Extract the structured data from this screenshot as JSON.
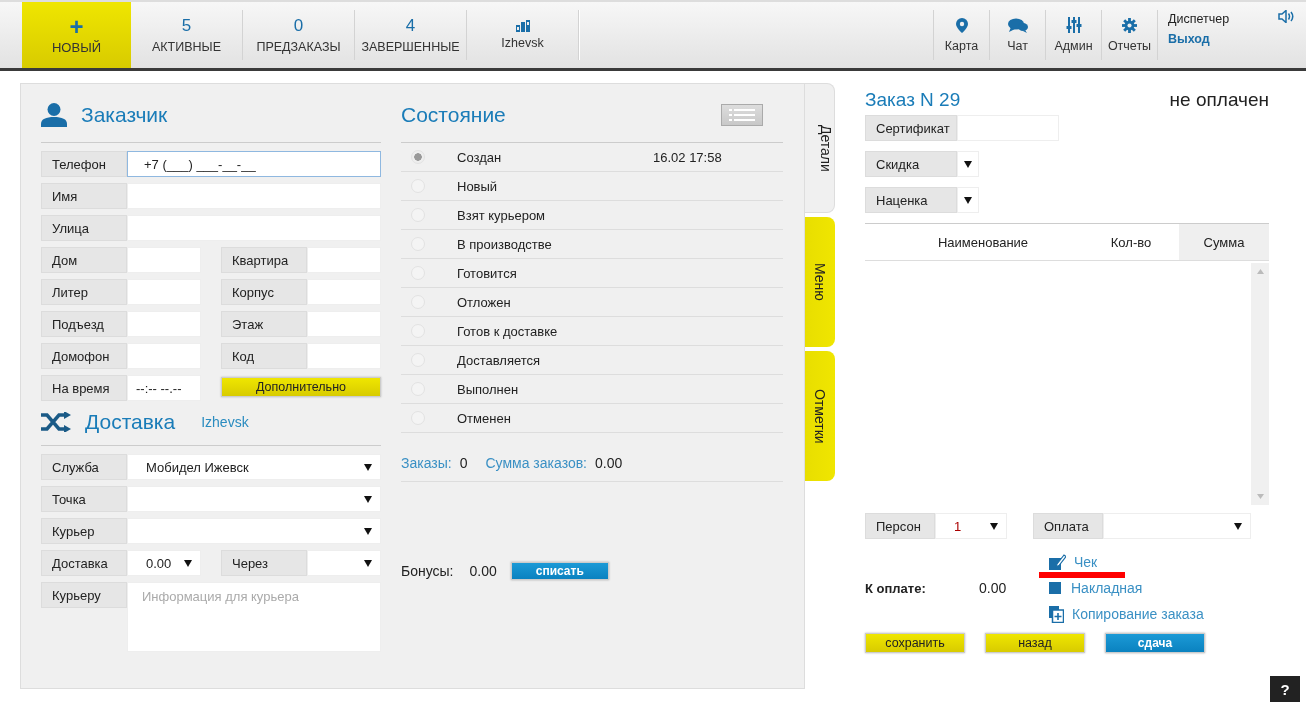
{
  "nav": {
    "new_button": {
      "icon": "+",
      "label": "НОВЫЙ"
    },
    "tabs": [
      {
        "count": "5",
        "label": "АКТИВНЫЕ"
      },
      {
        "count": "0",
        "label": "ПРЕДЗАКАЗЫ"
      },
      {
        "count": "4",
        "label": "ЗАВЕРШЕННЫЕ"
      }
    ],
    "city": "Izhevsk",
    "tools": [
      {
        "kind": "map",
        "label": "Карта"
      },
      {
        "kind": "chat",
        "label": "Чат"
      },
      {
        "kind": "admin",
        "label": "Админ"
      },
      {
        "kind": "reports",
        "label": "Отчеты"
      }
    ],
    "user": {
      "role": "Диспетчер",
      "logout": "Выход"
    }
  },
  "customer": {
    "title": "Заказчик",
    "rows": [
      {
        "cells": [
          {
            "kind": "input",
            "label": "Телефон",
            "value": "+7 (___) ___-__-__",
            "focused": true
          }
        ]
      },
      {
        "cells": [
          {
            "kind": "input",
            "label": "Имя",
            "focused": false
          }
        ]
      },
      {
        "cells": [
          {
            "kind": "input",
            "label": "Улица",
            "focused": false
          }
        ]
      },
      {
        "cells": [
          {
            "kind": "input",
            "label": "Дом",
            "focused": false
          },
          {
            "kind": "input",
            "label": "Квартира",
            "focused": false
          }
        ]
      },
      {
        "cells": [
          {
            "kind": "input",
            "label": "Литер",
            "focused": false
          },
          {
            "kind": "input",
            "label": "Корпус",
            "focused": false
          }
        ]
      },
      {
        "cells": [
          {
            "kind": "input",
            "label": "Подъезд",
            "focused": false
          },
          {
            "kind": "input",
            "label": "Этаж",
            "focused": false
          }
        ]
      },
      {
        "cells": [
          {
            "kind": "input",
            "label": "Домофон",
            "focused": false
          },
          {
            "kind": "input",
            "label": "Код",
            "focused": false
          }
        ]
      },
      {
        "cells": [
          {
            "kind": "input",
            "label": "На время",
            "value": "--:-- --.--",
            "focused": false
          },
          {
            "kind": "button",
            "label": "Дополнительно"
          }
        ]
      }
    ]
  },
  "delivery": {
    "title": "Доставка",
    "city": "Izhevsk",
    "rows": [
      {
        "cells": [
          {
            "kind": "select",
            "label": "Служба",
            "value": "Мобидел Ижевск"
          }
        ]
      },
      {
        "cells": [
          {
            "kind": "select",
            "label": "Точка"
          }
        ]
      },
      {
        "cells": [
          {
            "kind": "select",
            "label": "Курьер"
          }
        ]
      },
      {
        "cells": [
          {
            "kind": "select",
            "label": "Доставка",
            "value": "0.00"
          },
          {
            "kind": "select",
            "label": "Через"
          }
        ]
      },
      {
        "cells": [
          {
            "kind": "textarea",
            "label": "Курьеру",
            "placeholder": "Информация для курьера"
          }
        ]
      }
    ]
  },
  "status": {
    "title": "Состояние",
    "items": [
      {
        "label": "Создан",
        "selected": true,
        "time": "16.02 17:58"
      },
      {
        "label": "Новый",
        "selected": false
      },
      {
        "label": "Взят курьером",
        "selected": false
      },
      {
        "label": "В производстве",
        "selected": false
      },
      {
        "label": "Готовится",
        "selected": false
      },
      {
        "label": "Отложен",
        "selected": false
      },
      {
        "label": "Готов к доставке",
        "selected": false
      },
      {
        "label": "Доставляется",
        "selected": false
      },
      {
        "label": "Выполнен",
        "selected": false
      },
      {
        "label": "Отменен",
        "selected": false
      }
    ],
    "summary": [
      {
        "label": "Заказы:",
        "value": "0"
      },
      {
        "label": "Сумма заказов:",
        "value": "0.00"
      }
    ],
    "bonus": {
      "label": "Бонусы:",
      "value": "0.00",
      "button": "списать"
    }
  },
  "side_tabs": [
    {
      "label": "Детали",
      "selected": true
    },
    {
      "label": "Меню",
      "selected": false
    },
    {
      "label": "Отметки",
      "selected": false
    }
  ],
  "order": {
    "title": "Заказ N 29",
    "payment_status": "не оплачен",
    "fields": [
      {
        "kind": "input",
        "label": "Сертификат"
      },
      {
        "kind": "select",
        "label": "Скидка"
      },
      {
        "kind": "select",
        "label": "Наценка"
      }
    ],
    "table": {
      "columns": [
        {
          "label": "Наименование",
          "sorted": false
        },
        {
          "label": "Кол-во",
          "sorted": false
        },
        {
          "label": "Сумма",
          "sorted": true
        }
      ]
    },
    "bottom_fields": [
      {
        "kind": "select",
        "label": "Персон",
        "value": "1"
      },
      {
        "kind": "select",
        "label": "Оплата"
      }
    ],
    "total": {
      "label": "К оплате:",
      "value": "0.00"
    },
    "links": [
      {
        "kind": "receipt",
        "label": "Чек"
      },
      {
        "kind": "invoice",
        "label": "Накладная"
      },
      {
        "kind": "copy",
        "label": "Копирование заказа"
      }
    ],
    "buttons": [
      {
        "kind": "accent",
        "label": "сохранить"
      },
      {
        "kind": "accent",
        "label": "назад"
      },
      {
        "kind": "primary",
        "label": "сдача"
      }
    ]
  },
  "help_button": "?"
}
